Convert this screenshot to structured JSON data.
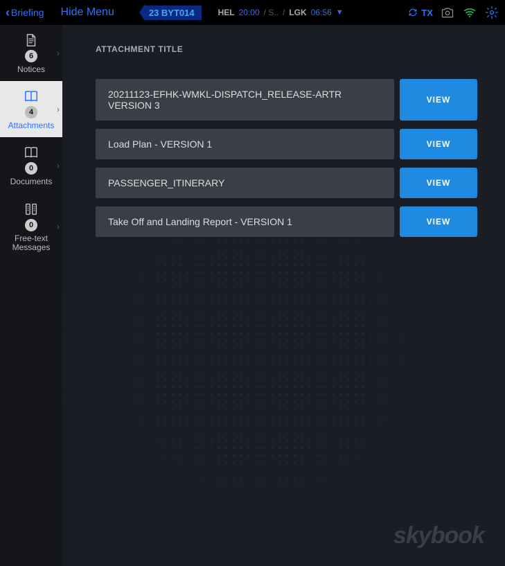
{
  "topbar": {
    "back_label": "Briefing",
    "hide_menu": "Hide Menu",
    "flight_id": "23 BYT014",
    "leg1_code": "HEL",
    "leg1_time": "20:00",
    "leg_sep1": "/ S..",
    "leg_sep2": "/",
    "leg2_code": "LGK",
    "leg2_time": "06:56",
    "tx_label": "TX"
  },
  "sidebar": {
    "items": [
      {
        "label": "Notices",
        "badge": "6"
      },
      {
        "label": "Attachments",
        "badge": "4"
      },
      {
        "label": "Documents",
        "badge": "0"
      },
      {
        "label": "Free-text Messages",
        "badge": "0"
      }
    ]
  },
  "main": {
    "section_title": "ATTACHMENT TITLE",
    "view_label": "VIEW",
    "attachments": [
      {
        "title": "20211123-EFHK-WMKL-DISPATCH_RELEASE-ARTR VERSION 3"
      },
      {
        "title": "Load Plan - VERSION 1"
      },
      {
        "title": "PASSENGER_ITINERARY"
      },
      {
        "title": "Take Off and Landing Report - VERSION 1"
      }
    ]
  },
  "brand": "skybook"
}
